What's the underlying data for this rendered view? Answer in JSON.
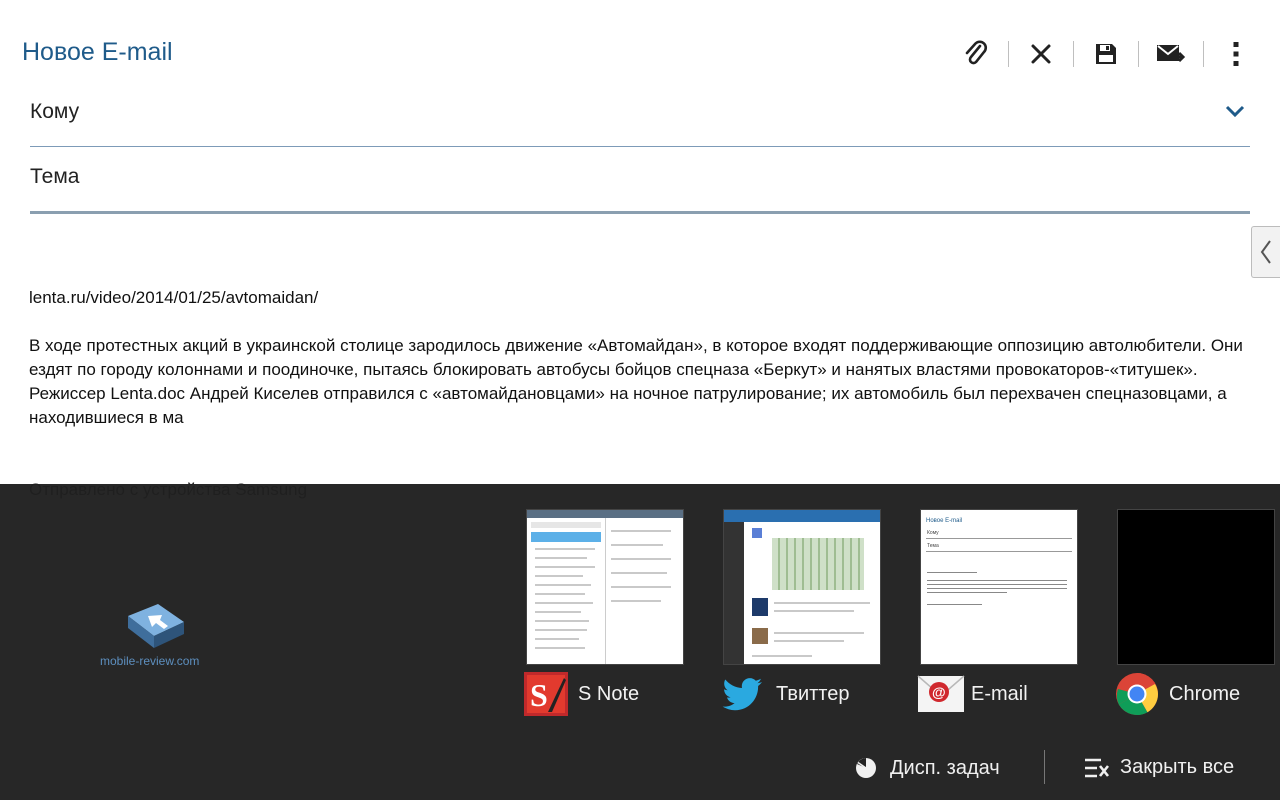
{
  "compose": {
    "title": "Новое E-mail",
    "to_label": "Кому",
    "subject_label": "Тема",
    "body_url": "lenta.ru/video/2014/01/25/avtomaidan/",
    "body_paragraph": "В ходе протестных акций в украинской столице зародилось движение «Автомайдан», в которое входят поддерживающие оппозицию автолюбители. Они ездят по городу колоннами и поодиночке, пытаясь блокировать автобусы бойцов спецназа «Беркут» и нанятых властями провокаторов-«титушек». Режиссер Lenta.doc Андрей Киселев отправился с «автомайдановцами» на ночное патрулирование; их автомобиль был перехвачен спецназовцами, а находившиеся в ма",
    "signature": "Отправлено с устройства Samsung",
    "accent": "#1f5b8a",
    "toolbar_icons": [
      "paperclip-icon",
      "close-icon",
      "save-icon",
      "send-icon",
      "overflow-menu-icon"
    ]
  },
  "recents": {
    "watermark": "mobile-review.com",
    "apps": [
      {
        "name": "S Note",
        "icon": "snote-icon"
      },
      {
        "name": "Твиттер",
        "icon": "twitter-icon"
      },
      {
        "name": "E-mail",
        "icon": "email-icon"
      },
      {
        "name": "Chrome",
        "icon": "chrome-icon"
      }
    ],
    "thumb_email": {
      "title": "Новое E-mail",
      "to": "Кому",
      "subject": "Тема"
    },
    "task_manager_label": "Дисп. задач",
    "close_all_label": "Закрыть все"
  }
}
